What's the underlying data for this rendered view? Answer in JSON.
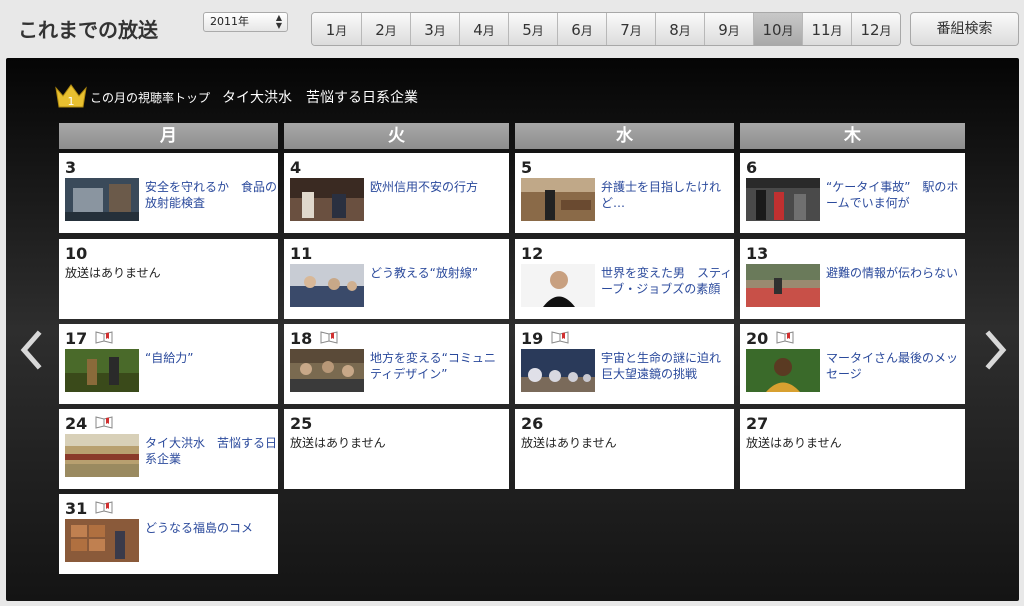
{
  "header": {
    "title": "これまでの放送",
    "year_select": {
      "value": "2011年"
    },
    "months": [
      {
        "num": "1",
        "suffix": "月"
      },
      {
        "num": "2",
        "suffix": "月"
      },
      {
        "num": "3",
        "suffix": "月"
      },
      {
        "num": "4",
        "suffix": "月"
      },
      {
        "num": "5",
        "suffix": "月"
      },
      {
        "num": "6",
        "suffix": "月"
      },
      {
        "num": "7",
        "suffix": "月"
      },
      {
        "num": "8",
        "suffix": "月"
      },
      {
        "num": "9",
        "suffix": "月"
      },
      {
        "num": "10",
        "suffix": "月"
      },
      {
        "num": "11",
        "suffix": "月"
      },
      {
        "num": "12",
        "suffix": "月"
      }
    ],
    "active_month": "10",
    "search_label": "番組検索"
  },
  "top_rated": {
    "rank": "1",
    "label": "この月の視聴率トップ",
    "title": "タイ大洪水　苦悩する日系企業"
  },
  "weekdays": [
    "月",
    "火",
    "水",
    "木"
  ],
  "cells": {
    "c3": {
      "date": "3",
      "title": "安全を守れるか　食品の放射能検査"
    },
    "c4": {
      "date": "4",
      "title": "欧州信用不安の行方"
    },
    "c5": {
      "date": "5",
      "title": "弁護士を目指したけれど…"
    },
    "c6": {
      "date": "6",
      "title": "“ケータイ事故”　駅のホームでいま何が"
    },
    "c10": {
      "date": "10",
      "none": "放送はありません"
    },
    "c11": {
      "date": "11",
      "title": "どう教える“放射線”"
    },
    "c12": {
      "date": "12",
      "title": "世界を変えた男　スティーブ・ジョブズの素顔"
    },
    "c13": {
      "date": "13",
      "title": "避難の情報が伝わらない"
    },
    "c17": {
      "date": "17",
      "title": "“自給力”"
    },
    "c18": {
      "date": "18",
      "title": "地方を変える“コミュニティデザイン”"
    },
    "c19": {
      "date": "19",
      "title": "宇宙と生命の謎に迫れ　巨大望遠鏡の挑戦"
    },
    "c20": {
      "date": "20",
      "title": "マータイさん最後のメッセージ"
    },
    "c24": {
      "date": "24",
      "title": "タイ大洪水　苦悩する日系企業"
    },
    "c25": {
      "date": "25",
      "none": "放送はありません"
    },
    "c26": {
      "date": "26",
      "none": "放送はありません"
    },
    "c27": {
      "date": "27",
      "none": "放送はありません"
    },
    "c31": {
      "date": "31",
      "title": "どうなる福島のコメ"
    }
  },
  "icons": {
    "crown": "crown-icon",
    "book": "open-book-icon",
    "prev": "chevron-left-icon",
    "next": "chevron-right-icon"
  },
  "colors": {
    "link": "#2b4a9c",
    "crown": "#e8c030",
    "book": "#d03030"
  }
}
